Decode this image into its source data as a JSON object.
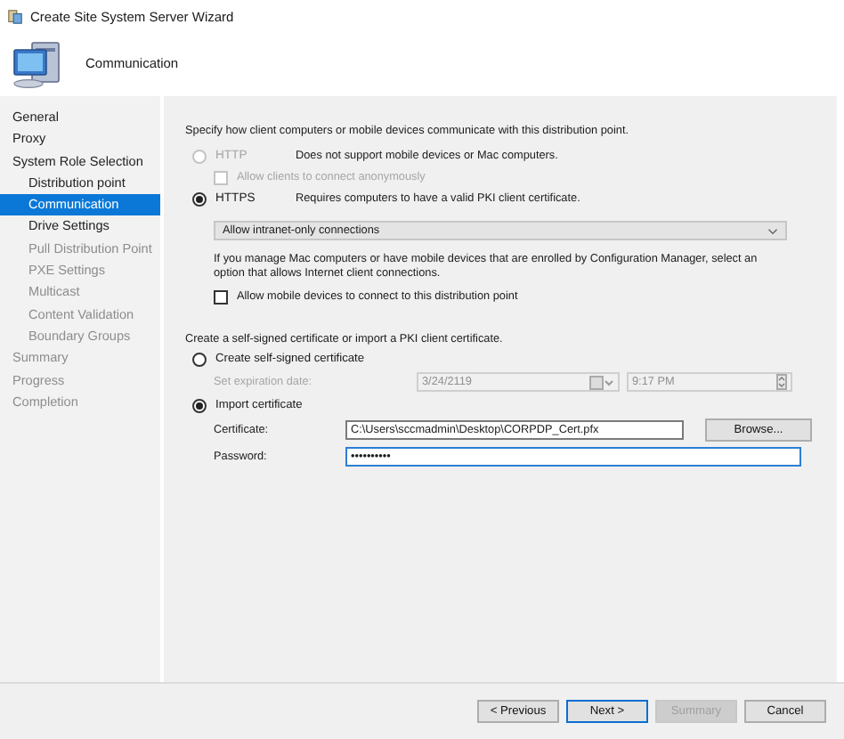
{
  "window": {
    "title": "Create Site System Server Wizard"
  },
  "header": {
    "title": "Communication"
  },
  "sidebar": {
    "items": [
      {
        "label": "General",
        "selected": false,
        "disabled": false
      },
      {
        "label": "Proxy",
        "selected": false,
        "disabled": false
      },
      {
        "label": "System Role Selection",
        "selected": false,
        "disabled": false,
        "children": [
          {
            "label": "Distribution point",
            "selected": false,
            "disabled": false
          },
          {
            "label": "Communication",
            "selected": true,
            "disabled": false
          },
          {
            "label": "Drive Settings",
            "selected": false,
            "disabled": false
          },
          {
            "label": "Pull Distribution Point",
            "selected": false,
            "disabled": true
          },
          {
            "label": "PXE Settings",
            "selected": false,
            "disabled": true
          },
          {
            "label": "Multicast",
            "selected": false,
            "disabled": true
          },
          {
            "label": "Content Validation",
            "selected": false,
            "disabled": true
          },
          {
            "label": "Boundary Groups",
            "selected": false,
            "disabled": true
          }
        ]
      },
      {
        "label": "Summary",
        "selected": false,
        "disabled": true
      },
      {
        "label": "Progress",
        "selected": false,
        "disabled": true
      },
      {
        "label": "Completion",
        "selected": false,
        "disabled": true
      }
    ]
  },
  "protocol": {
    "intro": "Specify how client computers or mobile devices communicate with this distribution point.",
    "options": [
      {
        "label": "HTTP",
        "description": "Does not support mobile devices or Mac computers.",
        "selected": false,
        "disabled": true,
        "checkbox": {
          "label": "Allow clients to connect anonymously",
          "checked": false,
          "disabled": true
        }
      },
      {
        "label": "HTTPS",
        "description": "Requires computers to have a valid PKI client certificate.",
        "selected": true,
        "disabled": false,
        "dropdown": {
          "value": "Allow intranet-only connections"
        },
        "note": "If you manage Mac computers or have mobile devices that are enrolled by Configuration Manager, select an option that allows Internet client connections.",
        "checkbox": {
          "label": "Allow mobile devices to connect to this distribution point",
          "checked": false,
          "disabled": false
        }
      }
    ]
  },
  "certificate": {
    "intro": "Create a self-signed certificate or import a PKI client certificate.",
    "options": [
      {
        "label": "Create self-signed certificate",
        "selected": false,
        "fields": [
          {
            "kind": "datetime",
            "label": "Set expiration date:",
            "date": "3/24/2119",
            "time": "9:17 PM",
            "disabled": true
          }
        ]
      },
      {
        "label": "Import certificate",
        "selected": true,
        "fields": [
          {
            "kind": "file",
            "label": "Certificate:",
            "value": "C:\\Users\\sccmadmin\\Desktop\\CORPDP_Cert.pfx",
            "button": "Browse...",
            "disabled": false
          },
          {
            "kind": "password",
            "label": "Password:",
            "value": "••••••••••",
            "focused": true,
            "disabled": false
          }
        ]
      }
    ]
  },
  "buttons": [
    {
      "label": "< Previous",
      "disabled": false,
      "default": false
    },
    {
      "label": "Next >",
      "disabled": false,
      "default": true
    },
    {
      "label": "Summary",
      "disabled": true,
      "default": false
    },
    {
      "label": "Cancel",
      "disabled": false,
      "default": false
    }
  ]
}
